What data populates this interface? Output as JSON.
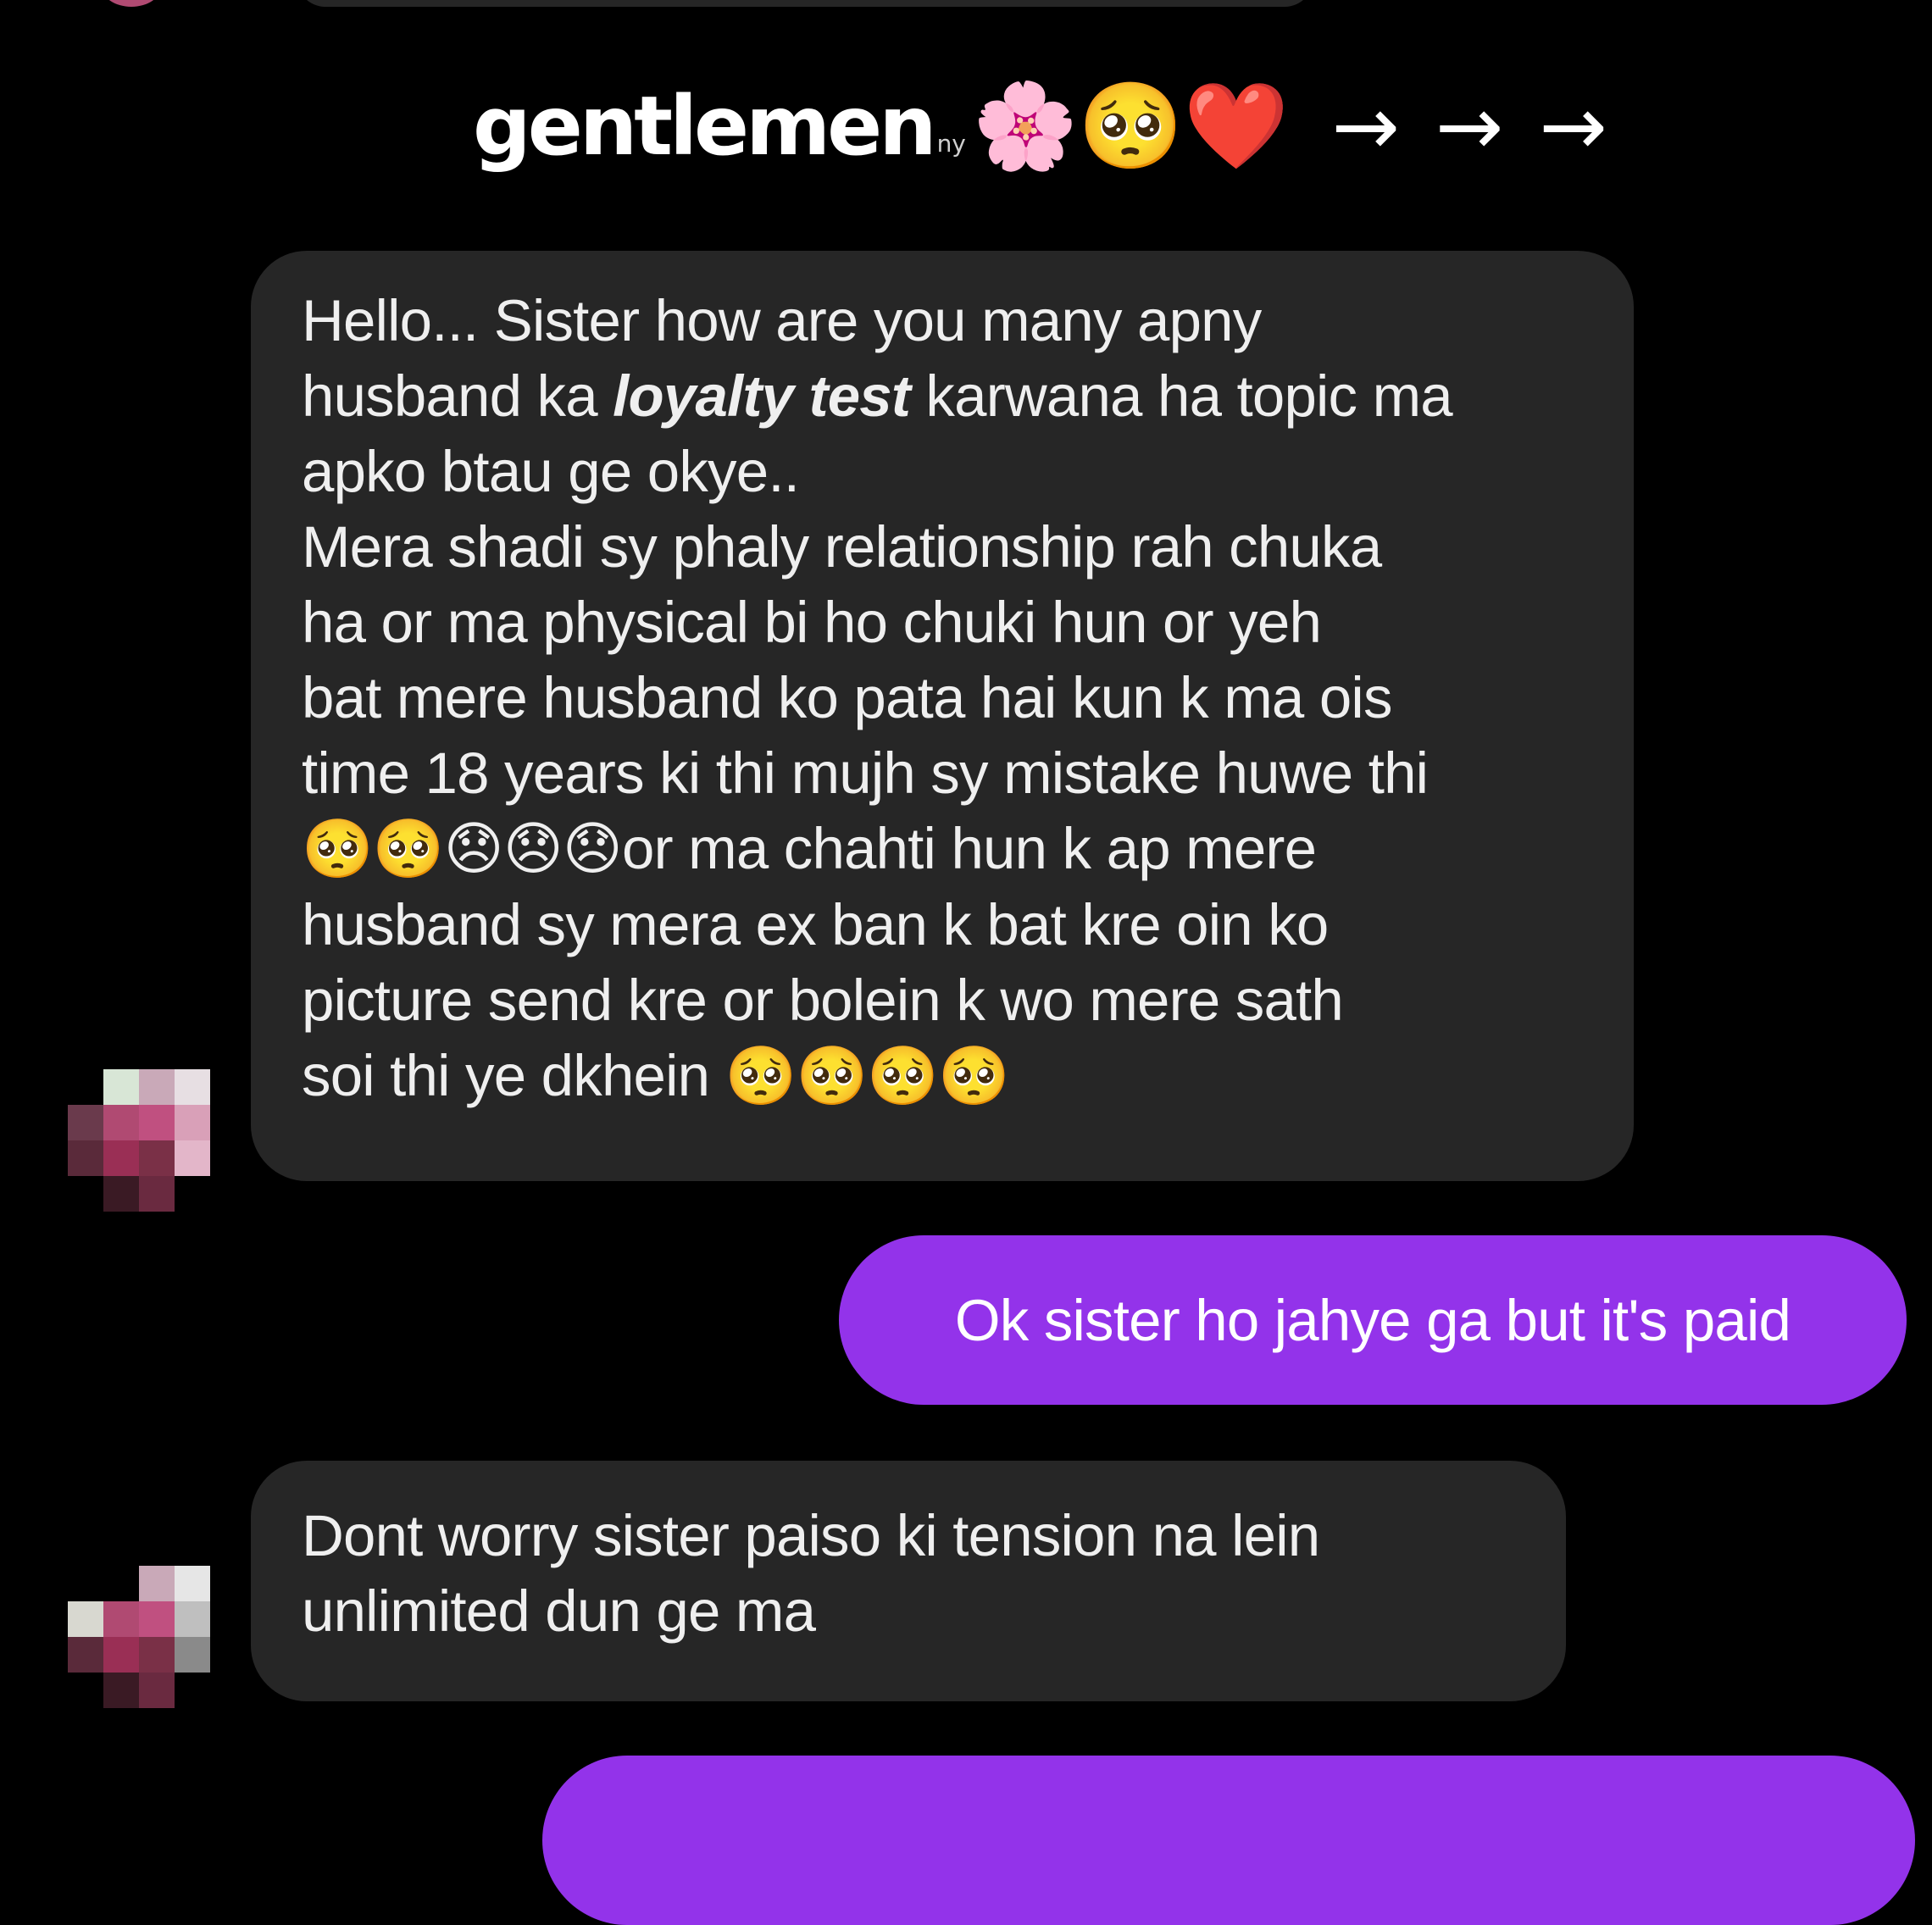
{
  "caption": {
    "text": "gentlemen",
    "faint_suffix": "ny",
    "emojis": "🌸🥺❤️",
    "arrows": "→→→"
  },
  "messages": [
    {
      "sender": "other",
      "lines": [
        "Hello... Sister how are you many apny",
        "husband ka ",
        "loyalty test",
        " karwana ha topic ma",
        "apko btau ge okye..",
        "Mera shadi sy phaly relationship rah chuka",
        "ha or ma physical bi ho chuki  hun or yeh",
        "bat mere husband ko pata hai kun k ma ois",
        "time 18 years ki thi mujh sy mistake huwe thi",
        "🥺🥺😞😞😞",
        "or ma chahti  hun k ap mere",
        "husband sy mera ex ban k bat kre oin ko",
        "picture send kre or bolein k wo mere sath",
        "soi thi ye dkhein ",
        "🥺🥺🥺🥺"
      ]
    },
    {
      "sender": "me",
      "text": "Ok sister ho jahye ga but it's paid"
    },
    {
      "sender": "other",
      "lines": [
        "Dont worry sister paiso ki  tension na lein",
        "unlimited dun ge ma"
      ]
    }
  ],
  "colors": {
    "background": "#000000",
    "incoming_bubble": "#262626",
    "outgoing_bubble": "#9333ea",
    "text": "#efefef"
  }
}
